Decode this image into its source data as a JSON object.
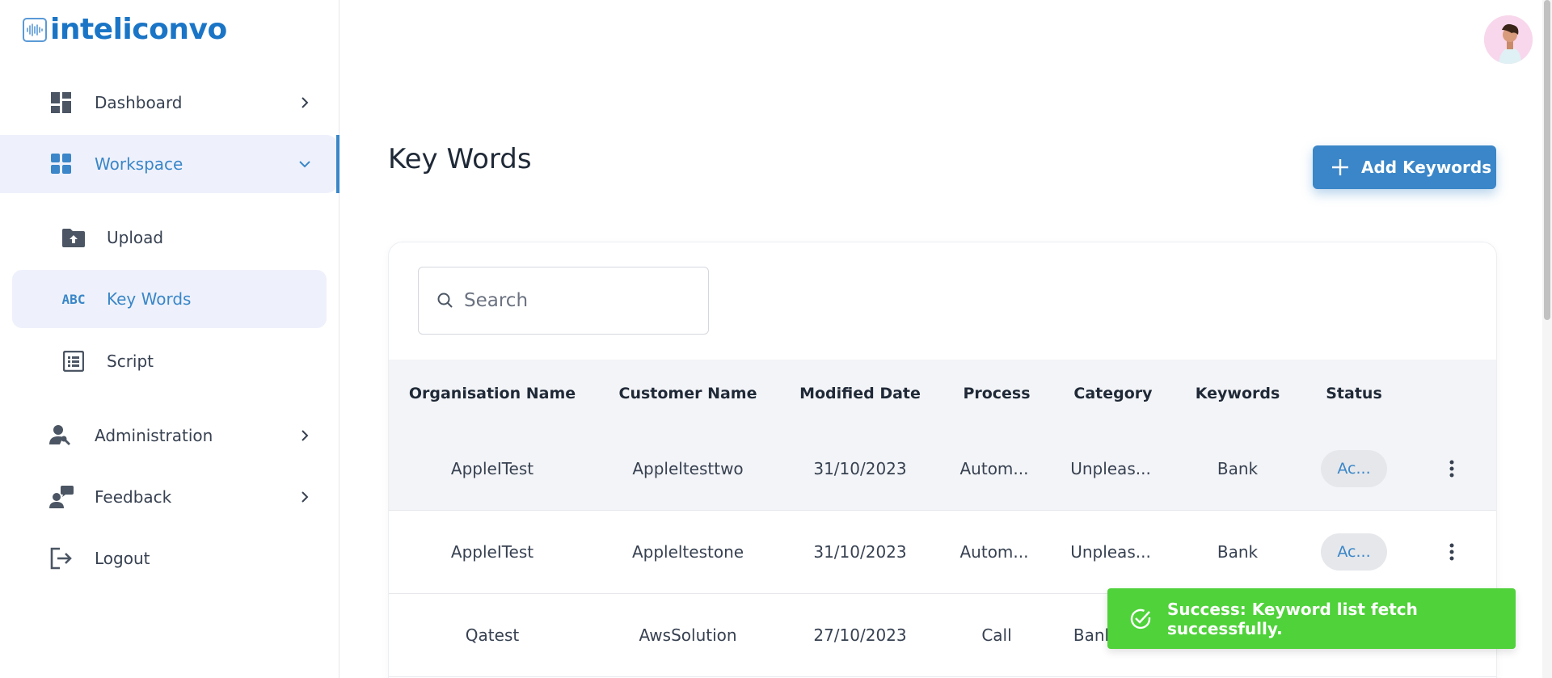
{
  "brand": {
    "name": "inteliconvo",
    "accent": "#3a86c8",
    "logo_color": "#1b75c6"
  },
  "sidebar": {
    "items": [
      {
        "label": "Dashboard",
        "icon": "dashboard-icon",
        "chevron": "chevron-right-icon"
      },
      {
        "label": "Workspace",
        "icon": "grid-icon",
        "chevron": "chevron-down-icon",
        "active": true
      },
      {
        "label": "Administration",
        "icon": "admin-user-wrench-icon",
        "chevron": "chevron-right-icon"
      },
      {
        "label": "Feedback",
        "icon": "feedback-icon",
        "chevron": "chevron-right-icon"
      },
      {
        "label": "Logout",
        "icon": "logout-icon"
      }
    ],
    "subitems": [
      {
        "label": "Upload",
        "icon": "folder-upload-icon"
      },
      {
        "label": "Key Words",
        "icon": "abc-icon",
        "icon_text": "ABC",
        "active": true
      },
      {
        "label": "Script",
        "icon": "list-alt-icon"
      }
    ]
  },
  "header": {
    "avatar": "user-avatar"
  },
  "page": {
    "title": "Key Words",
    "add_button": "Add Keywords",
    "search_placeholder": "Search"
  },
  "table": {
    "columns": [
      "Organisation Name",
      "Customer Name",
      "Modified Date",
      "Process",
      "Category",
      "Keywords",
      "Status"
    ],
    "rows": [
      {
        "org": "AppleITest",
        "customer": "Appleltesttwo",
        "date": "31/10/2023",
        "process": "Autom...",
        "category": "Unpleas...",
        "keywords": "Bank",
        "status": "Ac..."
      },
      {
        "org": "AppleITest",
        "customer": "Appleltestone",
        "date": "31/10/2023",
        "process": "Autom...",
        "category": "Unpleas...",
        "keywords": "Bank",
        "status": "Ac..."
      },
      {
        "org": "Qatest",
        "customer": "AwsSolution",
        "date": "27/10/2023",
        "process": "Call",
        "category": "Bank",
        "keywords": "",
        "status": ""
      }
    ]
  },
  "toast": {
    "message": "Success: Keyword list fetch successfully.",
    "color": "#4fd23a"
  }
}
